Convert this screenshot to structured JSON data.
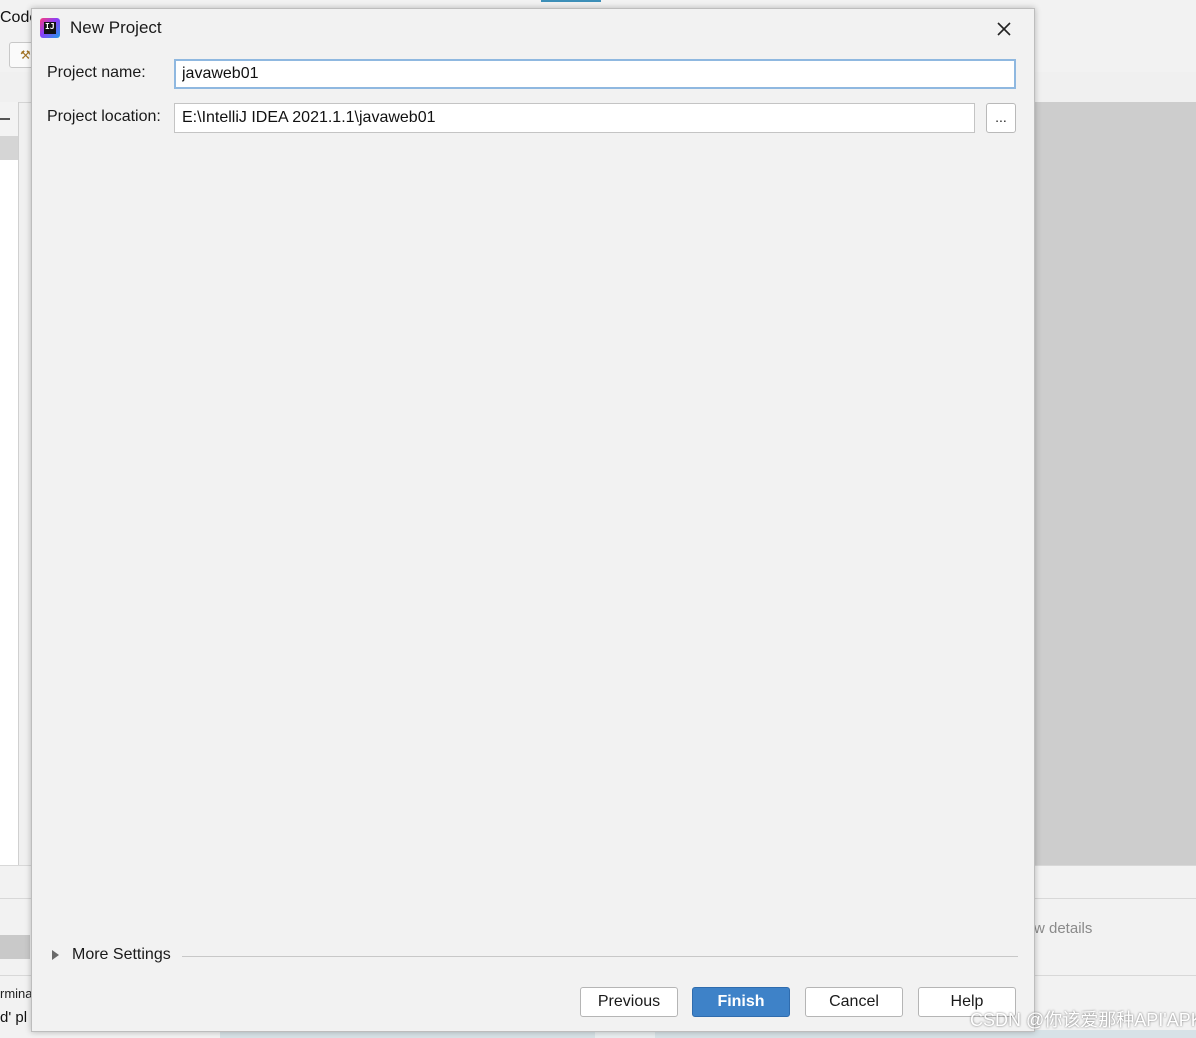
{
  "background": {
    "menu_fragment": "Code",
    "details_fragment": "w details",
    "terminal_fragment": "rmina",
    "bottom_fragment": "d' pl",
    "watermark": "CSDN @你该爱那种API'APK'"
  },
  "dialog": {
    "title": "New Project",
    "project_name_label": "Project name:",
    "project_name_value": "javaweb01",
    "project_location_label": "Project location:",
    "project_location_value": "E:\\IntelliJ IDEA 2021.1.1\\javaweb01",
    "browse_label": "...",
    "more_settings_label": "More Settings",
    "buttons": {
      "previous": "Previous",
      "finish": "Finish",
      "cancel": "Cancel",
      "help": "Help"
    }
  },
  "colors": {
    "primary_button": "#3e82c8",
    "focus_border": "#8fb8e0",
    "dialog_bg": "#f2f2f2"
  },
  "icons": {
    "app": "intellij-idea-icon",
    "close": "close-icon",
    "expand": "triangle-right-icon"
  }
}
